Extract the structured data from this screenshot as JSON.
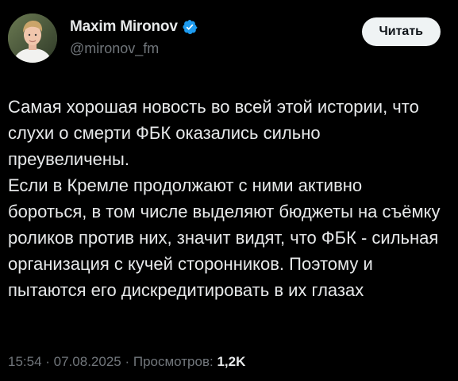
{
  "author": {
    "display_name": "Maxim Mironov",
    "handle": "@mironov_fm",
    "verified": true,
    "avatar_icon": "user-avatar"
  },
  "follow_button": {
    "label": "Читать"
  },
  "tweet": {
    "paragraph_1": "Самая хорошая новость во всей этой истории, что слухи о смерти ФБК оказались сильно преувеличены.",
    "paragraph_2": "Если в Кремле продолжают с ними активно бороться, в том числе выделяют бюджеты на съёмку роликов против них, значит видят, что ФБК - сильная организация с кучей сторонников. Поэтому и пытаются его дискредитировать в их глазах"
  },
  "meta": {
    "time": "15:54",
    "separator": " · ",
    "date": "07.08.2025",
    "views_label": "Просмотров:",
    "views_count": "1,2K"
  },
  "colors": {
    "background": "#000000",
    "text": "#e7e9ea",
    "secondary": "#71767b",
    "verified_badge": "#1d9bf0",
    "button_bg": "#eff3f4"
  }
}
